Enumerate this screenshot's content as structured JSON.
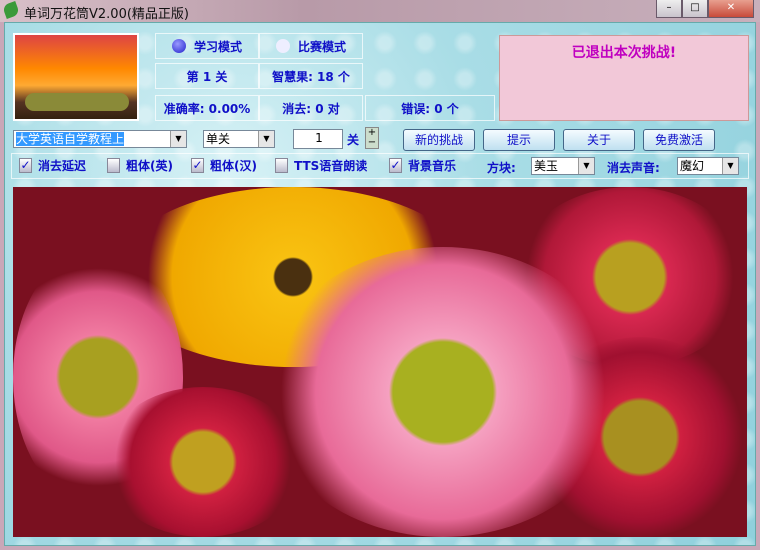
{
  "window": {
    "title": "单词万花筒V2.00(精品正版)",
    "min": "–",
    "max": "□",
    "close": "✕"
  },
  "mode": {
    "study": "学习模式",
    "contest": "比赛模式"
  },
  "stats": {
    "level": "第 1 关",
    "fruits": "智慧果: 18 个",
    "accuracy": "准确率: 0.00%",
    "cleared": "消去: 0 对",
    "errors": "错误: 0 个"
  },
  "message": "已退出本次挑战!",
  "controls": {
    "book": "大学英语自学教程上",
    "range": "单关",
    "level_value": "1",
    "level_unit": "关",
    "plus": "+",
    "minus": "−",
    "new_challenge": "新的挑战",
    "hint": "提示",
    "about": "关于",
    "activate": "免费激活"
  },
  "options": [
    {
      "label": "消去延迟",
      "checked": true
    },
    {
      "label": "粗体(英)",
      "checked": false
    },
    {
      "label": "粗体(汉)",
      "checked": true
    },
    {
      "label": "TTS语音朗读",
      "checked": false
    },
    {
      "label": "背景音乐",
      "checked": true
    }
  ],
  "block": {
    "label": "方块:",
    "value": "美玉"
  },
  "sound": {
    "label": "消去声音:",
    "value": "魔幻"
  },
  "check": "✓"
}
